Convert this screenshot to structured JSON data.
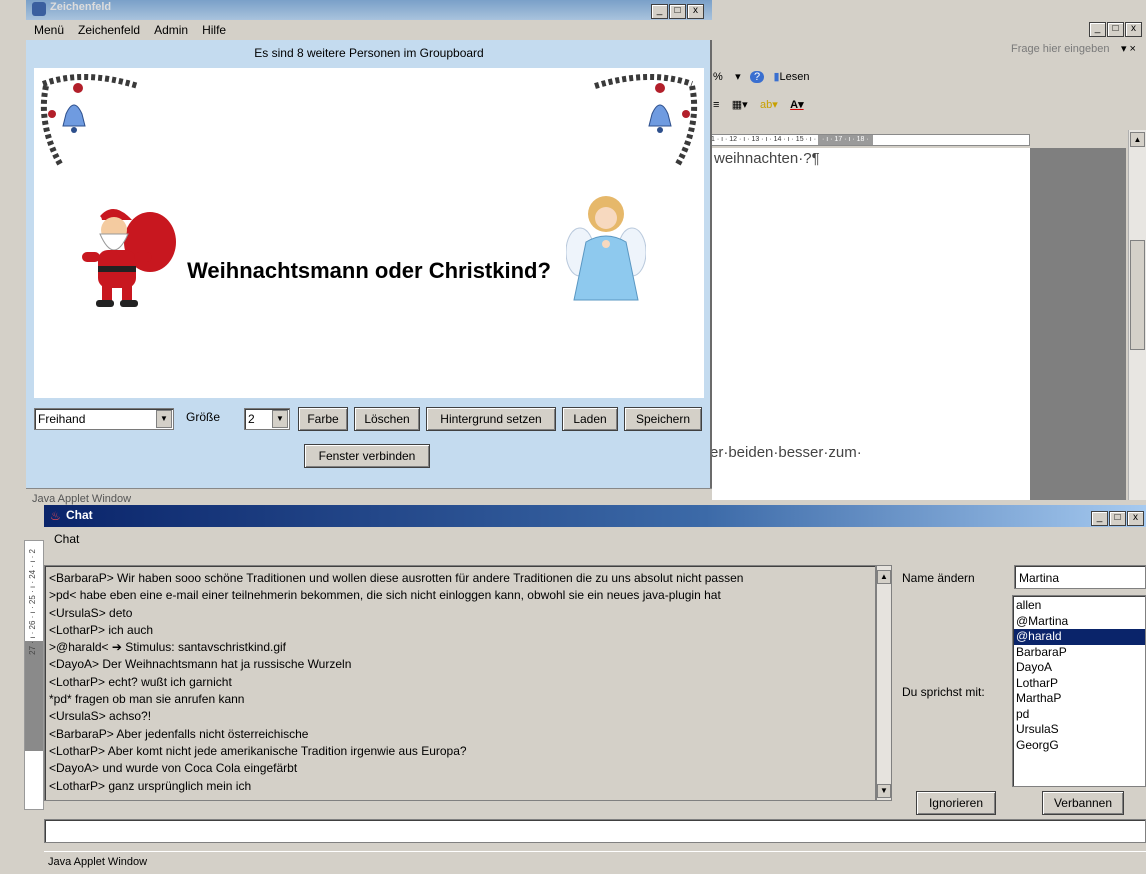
{
  "word": {
    "ask_placeholder": "Frage hier eingeben",
    "toolbar1": {
      "percent": "%",
      "lesen": "Lesen"
    },
    "ruler": "1 · ı · 12 · ı · 13 · ı · 14 · ı · 15 · ı ·",
    "ruler_grey": "· ı · 17 · ı · 18 ·",
    "doc_line1": "weihnachten·?¶",
    "doc_line2": "er·beiden·besser·zum·"
  },
  "zeichenfeld": {
    "title": "Zeichenfeld",
    "menu": [
      "Menü",
      "Zeichenfeld",
      "Admin",
      "Hilfe"
    ],
    "info": "Es sind 8 weitere Personen im Groupboard",
    "headline": "Weihnachtsmann oder Christkind?",
    "tool_select": "Freihand",
    "size_label": "Größe",
    "size_value": "2",
    "buttons": {
      "farbe": "Farbe",
      "loeschen": "Löschen",
      "hintergrund": "Hintergrund setzen",
      "laden": "Laden",
      "speichern": "Speichern",
      "verbinden": "Fenster verbinden"
    },
    "applet_status": "Java Applet Window"
  },
  "left_ruler": "27 · ı · 26 · ı · 25 · ı · 24 · ı · 2",
  "chat": {
    "title": "Chat",
    "menu": "Chat",
    "messages": [
      "<BarbaraP> Wir haben sooo schöne Traditionen und wollen diese ausrotten für andere Traditionen die zu uns absolut nicht passen",
      ">pd< habe eben eine e-mail einer teilnehmerin bekommen, die sich nicht einloggen kann, obwohl sie ein neues java-plugin hat",
      "<UrsulaS> deto",
      "<LotharP> ich auch",
      ">@harald< ➔      Stimulus: santavschristkind.gif",
      "<DayoA> Der Weihnachtsmann hat ja russische Wurzeln",
      "<LotharP> echt? wußt ich garnicht",
      "*pd* fragen ob man sie anrufen kann",
      "<UrsulaS> achso?!",
      "<BarbaraP> Aber jedenfalls nicht österreichische",
      "<LotharP> Aber komt nicht jede amerikanische Tradition irgenwie aus Europa?",
      "<DayoA> und wurde von Coca Cola eingefärbt",
      "<LotharP> ganz ursprünglich mein ich"
    ],
    "name_label": "Name ändern",
    "name_value": "Martina",
    "speak_label": "Du sprichst mit:",
    "users": [
      "allen",
      "@Martina",
      "@harald",
      "BarbaraP",
      "DayoA",
      "LotharP",
      "MarthaP",
      "pd",
      "UrsulaS",
      "GeorgG"
    ],
    "selected_user": "@harald",
    "ignore_button": "Ignorieren",
    "ban_button": "Verbannen",
    "status": "Java Applet Window"
  },
  "window_buttons": {
    "min": "_",
    "max": "□",
    "close": "x"
  },
  "colors": {
    "applet_bg": "#c4dbef",
    "chat_title": "#0a246a",
    "selection": "#0a246a"
  }
}
